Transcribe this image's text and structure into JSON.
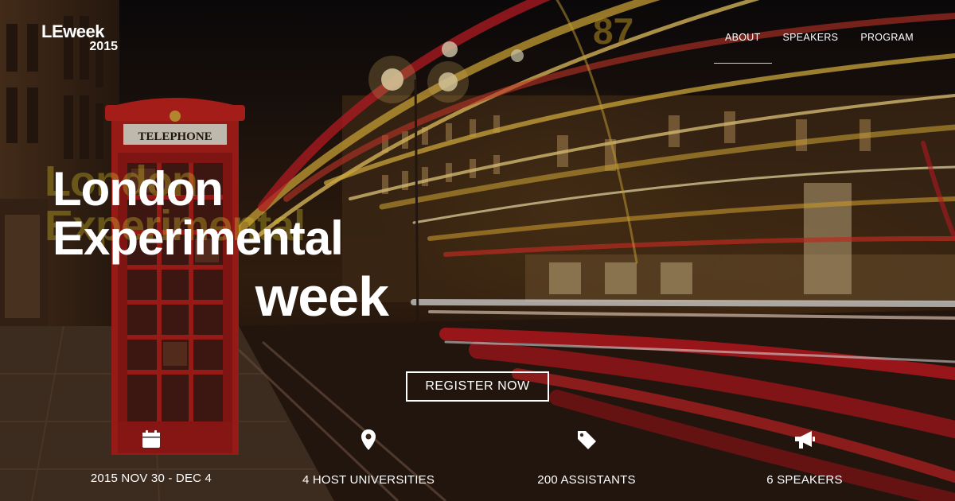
{
  "logo": {
    "main": "LEweek",
    "year": "2015"
  },
  "nav": {
    "items": [
      "ABOUT",
      "SPEAKERS",
      "PROGRAM"
    ],
    "active": "ABOUT"
  },
  "hero": {
    "line1": "London",
    "line2": "Experimental",
    "line3": "week",
    "phone_sign": "TELEPHONE",
    "bus_number": "87"
  },
  "cta": {
    "label": "REGISTER NOW"
  },
  "stats": [
    {
      "icon": "calendar-icon",
      "label": "2015 NOV 30 - DEC 4"
    },
    {
      "icon": "map-pin-icon",
      "label": "4 HOST UNIVERSITIES"
    },
    {
      "icon": "tag-icon",
      "label": "200 ASSISTANTS"
    },
    {
      "icon": "megaphone-icon",
      "label": "6 SPEAKERS"
    }
  ],
  "colors": {
    "accent_red": "#c0231e",
    "text": "#ffffff",
    "streak_yellow": "#f0c040"
  }
}
